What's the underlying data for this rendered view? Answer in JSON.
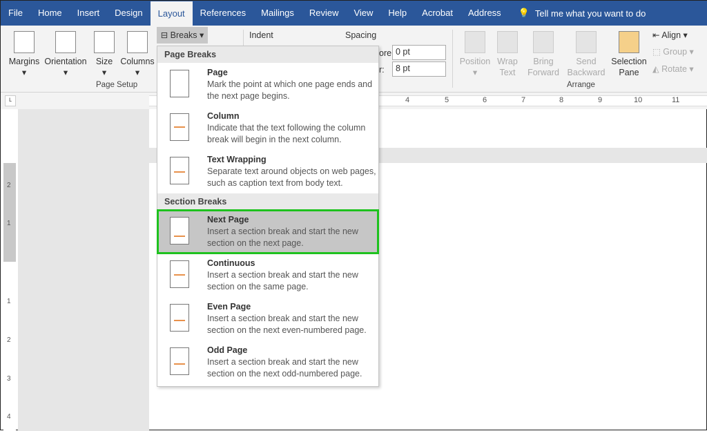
{
  "tabs": [
    "File",
    "Home",
    "Insert",
    "Design",
    "Layout",
    "References",
    "Mailings",
    "Review",
    "View",
    "Help",
    "Acrobat",
    "Address"
  ],
  "tell_me": "Tell me what you want to do",
  "ribbon": {
    "margins": "Margins",
    "orientation": "Orientation",
    "size": "Size",
    "columns": "Columns",
    "breaks": "Breaks",
    "page_setup": "Page Setup",
    "indent": "Indent",
    "spacing": "Spacing",
    "before_label": "ore:",
    "before": "0 pt",
    "after_label": "r:",
    "after": "8 pt",
    "position": "Position",
    "wrap1": "Wrap",
    "wrap2": "Text",
    "bring1": "Bring",
    "bring2": "Forward",
    "send1": "Send",
    "send2": "Backward",
    "sel1": "Selection",
    "sel2": "Pane",
    "align": "Align",
    "group": "Group",
    "rotate": "Rotate",
    "arrange": "Arrange"
  },
  "ruler": [
    "4",
    "5",
    "6",
    "7",
    "8",
    "9",
    "10",
    "11"
  ],
  "vruler": [
    "2",
    "1",
    "1",
    "2",
    "3",
    "4"
  ],
  "menu": {
    "page_breaks": "Page Breaks",
    "section_breaks": "Section Breaks",
    "items": [
      {
        "title": "Page",
        "desc": "Mark the point at which one page ends and the next page begins."
      },
      {
        "title": "Column",
        "desc": "Indicate that the text following the column break will begin in the next column."
      },
      {
        "title": "Text Wrapping",
        "desc": "Separate text around objects on web pages, such as caption text from body text."
      },
      {
        "title": "Next Page",
        "desc": "Insert a section break and start the new section on the next page."
      },
      {
        "title": "Continuous",
        "desc": "Insert a section break and start the new section on the same page."
      },
      {
        "title": "Even Page",
        "desc": "Insert a section break and start the new section on the next even-numbered page."
      },
      {
        "title": "Odd Page",
        "desc": "Insert a section break and start the new section on the next odd-numbered page."
      }
    ]
  },
  "colors": {
    "brand": "#2b579a",
    "highlight": "#1ec21e",
    "selected": "#c6c6c6"
  }
}
